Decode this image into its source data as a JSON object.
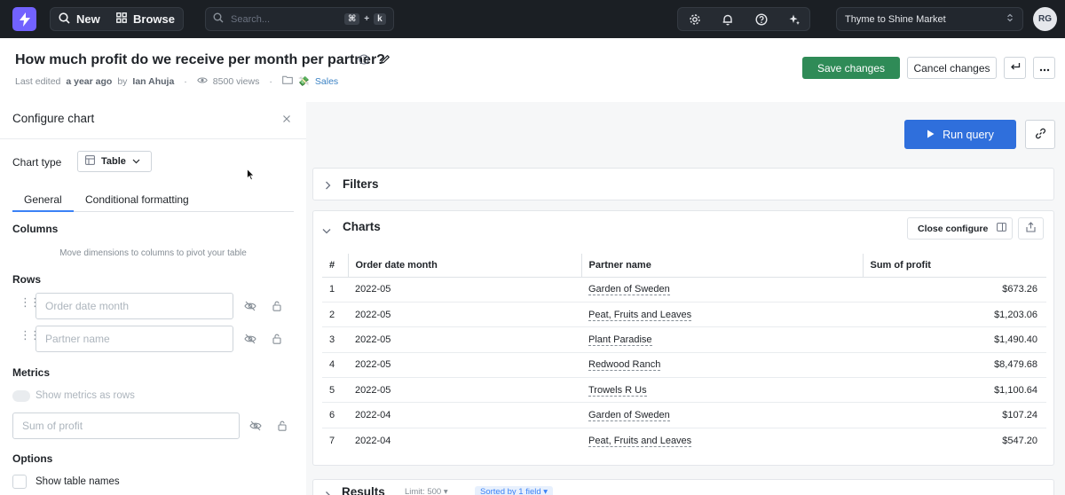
{
  "nav": {
    "new_label": "New",
    "browse_label": "Browse",
    "search_placeholder": "Search...",
    "shortcut_mod": "⌘",
    "shortcut_plus": "+",
    "shortcut_key": "k",
    "project_name": "Thyme to Shine Market",
    "avatar_initials": "RG",
    "icons": [
      "lightning-logo",
      "search-icon",
      "grid-icon",
      "gear-icon",
      "bell-icon",
      "help-icon",
      "sparkle-icon",
      "chevron-updown-icon"
    ]
  },
  "header": {
    "title": "How much profit do we receive per month per partner?",
    "meta_last_edited": "Last edited",
    "meta_when": "a year ago",
    "meta_by": "by",
    "meta_author": "Ian Ahuja",
    "meta_views": "8500 views",
    "meta_space_emoji": "💸",
    "meta_space": "Sales",
    "save_label": "Save changes",
    "cancel_label": "Cancel changes"
  },
  "config": {
    "title": "Configure chart",
    "chart_type_label": "Chart type",
    "chart_type_value": "Table",
    "tabs": [
      "General",
      "Conditional formatting"
    ],
    "active_tab": "General",
    "columns_heading": "Columns",
    "columns_hint": "Move dimensions to columns to pivot your table",
    "rows_heading": "Rows",
    "rows": [
      "Order date month",
      "Partner name"
    ],
    "metrics_heading": "Metrics",
    "show_metrics_label": "Show metrics as rows",
    "metrics": [
      "Sum of profit"
    ],
    "options_heading": "Options",
    "show_table_names_label": "Show table names"
  },
  "main": {
    "run_query_label": "Run query",
    "filters_title": "Filters",
    "charts_title": "Charts",
    "close_configure_label": "Close configure",
    "results_title": "Results",
    "limit_label": "Limit: 500",
    "sorted_label": "Sorted by 1 field"
  },
  "table": {
    "headers": [
      "#",
      "Order date month",
      "Partner name",
      "Sum of profit"
    ],
    "rows": [
      [
        "1",
        "2022-05",
        "Garden of Sweden",
        "$673.26"
      ],
      [
        "2",
        "2022-05",
        "Peat, Fruits and Leaves",
        "$1,203.06"
      ],
      [
        "3",
        "2022-05",
        "Plant Paradise",
        "$1,490.40"
      ],
      [
        "4",
        "2022-05",
        "Redwood Ranch",
        "$8,479.68"
      ],
      [
        "5",
        "2022-05",
        "Trowels R Us",
        "$1,100.64"
      ],
      [
        "6",
        "2022-04",
        "Garden of Sweden",
        "$107.24"
      ],
      [
        "7",
        "2022-04",
        "Peat, Fruits and Leaves",
        "$547.20"
      ]
    ]
  },
  "colors": {
    "nav_bg": "#1b1f24",
    "brand": "#7262ff",
    "save_green": "#2f8b57",
    "run_blue": "#2f6fdc",
    "tab_accent": "#3b82f6"
  }
}
